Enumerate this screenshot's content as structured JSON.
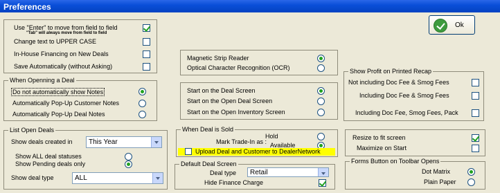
{
  "window": {
    "title": "Preferences"
  },
  "ok_button": {
    "label": "Ok"
  },
  "general": {
    "enter_label": "Use \"Enter\" to move from field to field",
    "tab_note": "\"Tab\" will always move from field to field",
    "upper_label": "Change text to UPPER CASE",
    "inhouse_label": "In-House Financing on New Deals",
    "save_label": "Save Automatically (without Asking)"
  },
  "opening_deal": {
    "title": "When Openning a Deal",
    "opt1": "Do not automatically show Notes",
    "opt2": "Automatically Pop-Up Customer Notes",
    "opt3": "Automatically Pop-Up Deal Notes"
  },
  "list_open_deals": {
    "title": "List Open Deals",
    "created_label": "Show deals created in",
    "created_value": "This Year",
    "all_status_label": "Show ALL deal statuses",
    "pending_label": "Show Pending deals only",
    "deal_type_label": "Show deal type",
    "deal_type_value": "ALL"
  },
  "reader": {
    "magnetic": "Magnetic Strip Reader",
    "ocr": "Optical Character Recognition (OCR)"
  },
  "start_screen": {
    "deal": "Start on the Deal Screen",
    "open_deal": "Start on the Open Deal Screen",
    "inventory": "Start on the Open Inventory Screen"
  },
  "deal_sold": {
    "title": "When Deal is Sold",
    "mark_label": "Mark Trade-In as :",
    "hold": "Hold",
    "available": "Available",
    "upload": "Upload Deal and Customer to DealerNetwork"
  },
  "default_deal": {
    "title": "Default Deal Screen",
    "type_label": "Deal type",
    "type_value": "Retail",
    "hide_label": "Hide Finance Charge"
  },
  "recap": {
    "title": "Show Profit on Printed Recap",
    "opt1": "Not including Doc Fee & Smog Fees",
    "opt2": "Including Doc Fee & Smog Fees",
    "opt3": "Including Doc Fee, Smog Fees, Pack"
  },
  "screen": {
    "resize": "Resize to fit screen",
    "maximize": "Maximize on Start"
  },
  "forms_button": {
    "title": "Forms Button on Toolbar Opens",
    "dot_matrix": "Dot Matrix",
    "plain_paper": "Plain Paper"
  },
  "colors": {
    "title_bar": "#0a4fd8",
    "client_bg": "#ece9d8",
    "accent_green": "#21a121",
    "highlight": "#ffff00"
  }
}
